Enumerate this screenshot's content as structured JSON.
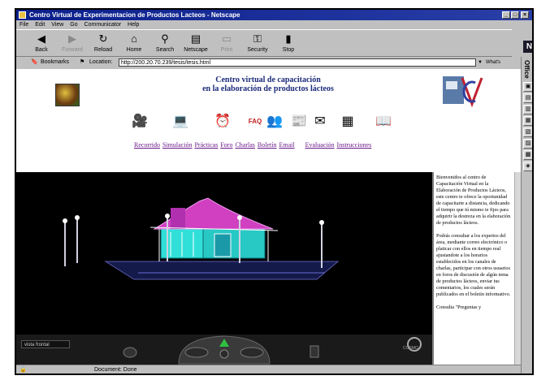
{
  "window": {
    "title": "Centro Virtual de Experimentacion de Productos Lacteos - Netscape",
    "buttons": [
      "_",
      "□",
      "×"
    ]
  },
  "menu": [
    "File",
    "Edit",
    "View",
    "Go",
    "Communicator",
    "Help"
  ],
  "toolbar": [
    {
      "label": "Back",
      "icon": "back-arrow-icon",
      "glyph": "◀",
      "enabled": true
    },
    {
      "label": "Forward",
      "icon": "forward-arrow-icon",
      "glyph": "▶",
      "enabled": false
    },
    {
      "label": "Reload",
      "icon": "reload-icon",
      "glyph": "↻",
      "enabled": true
    },
    {
      "label": "Home",
      "icon": "home-icon",
      "glyph": "⌂",
      "enabled": true
    },
    {
      "label": "Search",
      "icon": "search-icon",
      "glyph": "⚲",
      "enabled": true
    },
    {
      "label": "Netscape",
      "icon": "netscape-icon",
      "glyph": "▤",
      "enabled": true
    },
    {
      "label": "Print",
      "icon": "print-icon",
      "glyph": "▭",
      "enabled": false
    },
    {
      "label": "Security",
      "icon": "security-icon",
      "glyph": "⚿",
      "enabled": true
    },
    {
      "label": "Stop",
      "icon": "stop-icon",
      "glyph": "▮",
      "enabled": true
    }
  ],
  "location": {
    "bookmarks_label": "Bookmarks",
    "location_label": "Location:",
    "url": "http://200.20.70.239/tesis/tesis.html",
    "related_label": "What's Related"
  },
  "office_bar_label": "Office",
  "header": {
    "title_line1": "Centro virtual de capacitación",
    "title_line2": "en la elaboración de productos lácteos"
  },
  "nav_icons": [
    {
      "icon": "camera-icon",
      "glyph": "🎥"
    },
    {
      "icon": "computer-icon",
      "glyph": "💻"
    },
    {
      "icon": "clock-icon",
      "glyph": "⏰"
    },
    {
      "icon": "faq-icon",
      "glyph": "FAQ"
    },
    {
      "icon": "people-icon",
      "glyph": "👥"
    },
    {
      "icon": "newsletter-icon",
      "glyph": "📰"
    },
    {
      "icon": "email-icon",
      "glyph": "✉"
    },
    {
      "icon": "evaluation-icon",
      "glyph": "▦"
    },
    {
      "icon": "book-icon",
      "glyph": "📖"
    }
  ],
  "nav_links": [
    "Recorrido",
    "Simulación",
    "Prácticas",
    "Foro",
    "Charlas",
    "Boletín",
    "Email",
    "Evaluación",
    "Instrucciones"
  ],
  "sidebar": {
    "paragraph1": "Bienvenidos al centro de Capacitación Virtual en la Elaboración de Productos Lácteos, este centro te ofrece la oportunidad de capacitarte a distancia, dedicando el tiempo que tú mismo te fijes para adquirir la destreza en la elaboración de productos lácteos.",
    "paragraph2": "Podrás consultar a los expertos del área, mediante correo electrónico o platicar con ellos en tiempo real ajustandote a los horarios establecidos en los canales de charlas, participar con otros usuarios en foros de discusión de algún tema de productos lácteos, enviar tus comentarios, los cuales serán publicados en el boletín informativo.",
    "paragraph3": "Consulta \"Preguntas y"
  },
  "scene": {
    "view_label": "vista frontal",
    "viewer_brand": "COSMO"
  },
  "status": "Document: Done",
  "colors": {
    "title_bar": "#0a1f8a",
    "link": "#6a1a8a",
    "building_wall": "#30e0d8",
    "roof": "#d040c0"
  }
}
